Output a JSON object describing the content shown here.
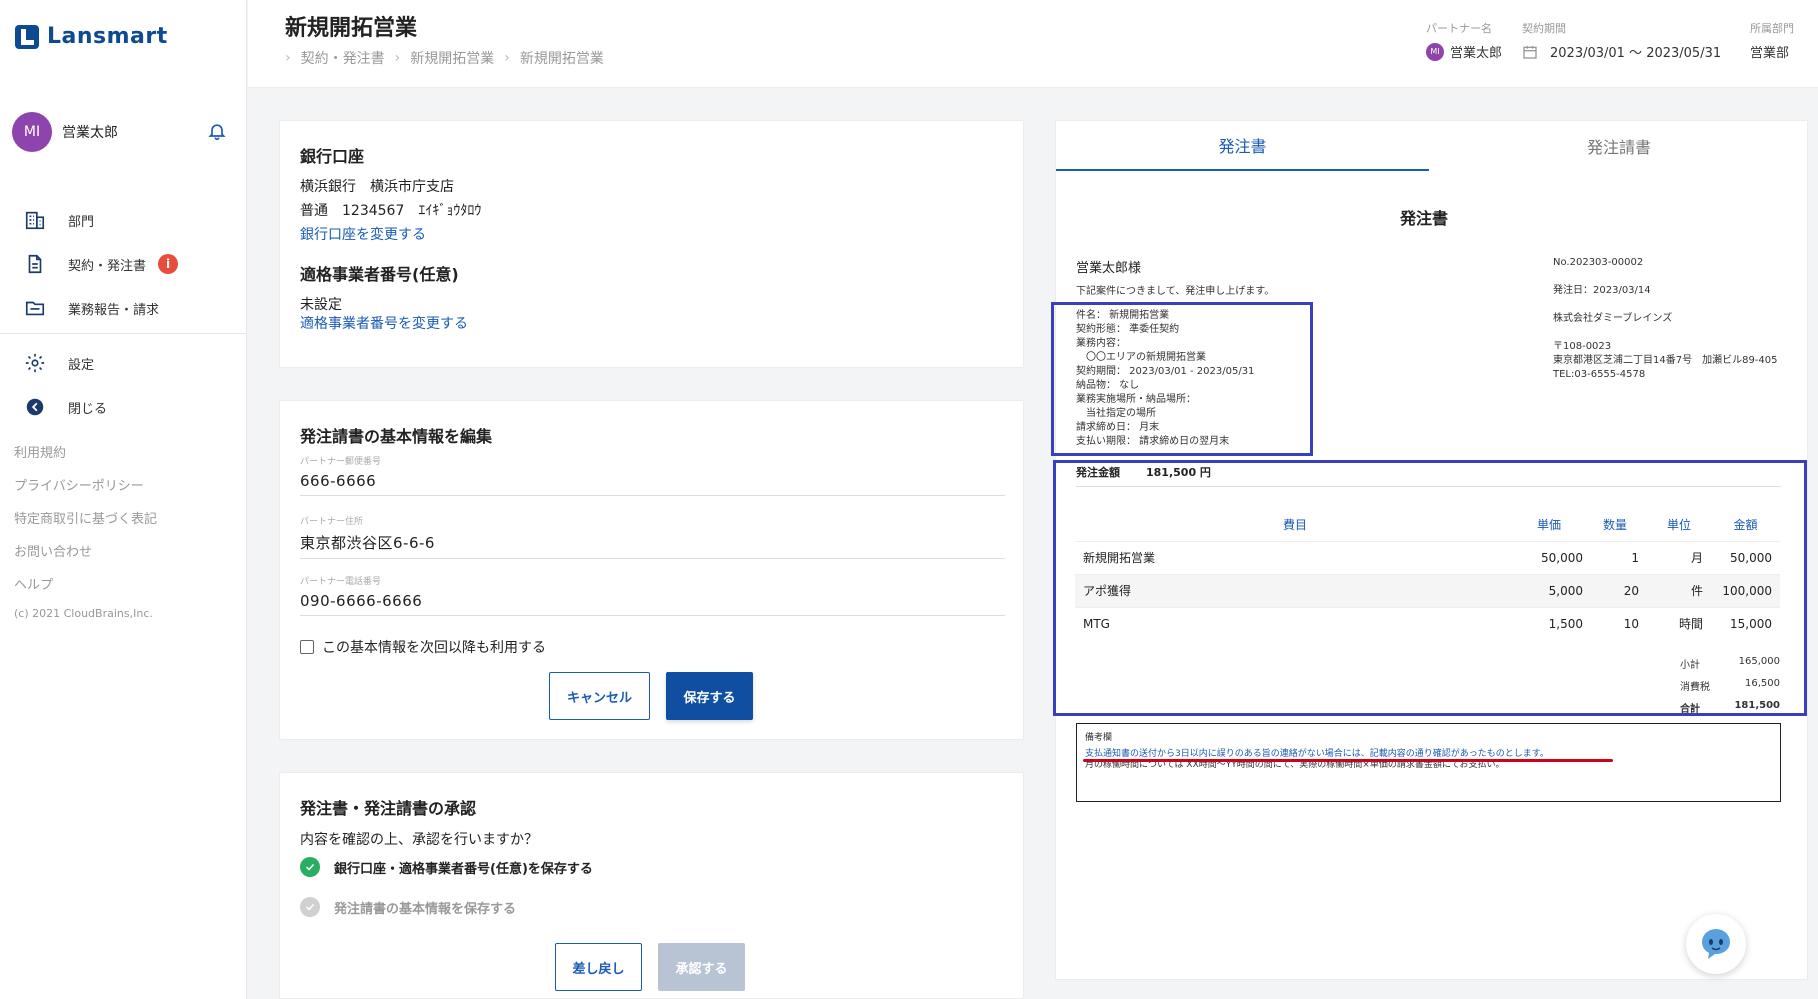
{
  "app": {
    "logo": "Lansmart"
  },
  "user": {
    "initials": "MI",
    "name": "営業太郎"
  },
  "nav": {
    "items": [
      {
        "label": "部門",
        "icon": "building-icon"
      },
      {
        "label": "契約・発注書",
        "icon": "document-icon",
        "badge": "i"
      },
      {
        "label": "業務報告・請求",
        "icon": "folder-icon"
      }
    ],
    "items2": [
      {
        "label": "設定",
        "icon": "gear-icon"
      },
      {
        "label": "閉じる",
        "icon": "arrow-left-icon"
      }
    ],
    "footer": [
      "利用規約",
      "プライバシーポリシー",
      "特定商取引に基づく表記",
      "お問い合わせ",
      "ヘルプ"
    ],
    "copyright": "(c) 2021 CloudBrains,Inc."
  },
  "header": {
    "title": "新規開拓営業",
    "breadcrumb": [
      "契約・発注書",
      "新規開拓営業",
      "新規開拓営業"
    ],
    "partner_label": "パートナー名",
    "partner_initials": "MI",
    "partner_name": "営業太郎",
    "period_label": "契約期間",
    "period_value": "2023/03/01 ～ 2023/05/31",
    "dept_label": "所属部門",
    "dept_value": "営業部"
  },
  "bank": {
    "title": "銀行口座",
    "line1": "横浜銀行　横浜市庁支店",
    "line2": "普通　1234567　ｴｲｷﾞｮｳﾀﾛｳ",
    "change_link": "銀行口座を変更する",
    "invoice_title": "適格事業者番号(任意)",
    "invoice_value": "未設定",
    "invoice_link": "適格事業者番号を変更する"
  },
  "basic": {
    "title": "発注請書の基本情報を編集",
    "fields": [
      {
        "label": "パートナー郵便番号",
        "value": "666-6666"
      },
      {
        "label": "パートナー住所",
        "value": "東京都渋谷区6-6-6"
      },
      {
        "label": "パートナー電話番号",
        "value": "090-6666-6666"
      }
    ],
    "reuse_checkbox": "この基本情報を次回以降も利用する",
    "cancel": "キャンセル",
    "save": "保存する"
  },
  "approval": {
    "title": "発注書・発注請書の承認",
    "question": "内容を確認の上、承認を行いますか？",
    "step1": "銀行口座・適格事業者番号(任意)を保存する",
    "step2": "発注請書の基本情報を保存する",
    "reject": "差し戻し",
    "approve": "承認する"
  },
  "tabs": {
    "active": "発注書",
    "inactive": "発注請書"
  },
  "doc": {
    "title": "発注書",
    "to": "営業太郎様",
    "intro": "下記案件につきまして、発注申し上げます。",
    "details": [
      "件名：  新規開拓営業",
      "契約形態：  準委任契約",
      "業務内容：",
      "　〇〇エリアの新規開拓営業",
      "契約期間：  2023/03/01 - 2023/05/31",
      "納品物：  なし",
      "業務実施場所・納品場所：",
      "　当社指定の場所",
      "請求締め日：  月末",
      "支払い期限：  請求締め日の翌月末"
    ],
    "number": "No.202303-00002",
    "issue_date": "発注日：2023/03/14",
    "company": "株式会社ダミーブレインズ",
    "postal": "〒108-0023",
    "address": "東京都港区芝浦二丁目14番7号　加瀬ビル89-405",
    "tel": "TEL:03-6555-4578",
    "amount_label": "発注金額",
    "amount_value": "181,500 円",
    "table_headers": [
      "費目",
      "単価",
      "数量",
      "単位",
      "金額"
    ],
    "rows": [
      [
        "新規開拓営業",
        "50,000",
        "1",
        "月",
        "50,000"
      ],
      [
        "アポ獲得",
        "5,000",
        "20",
        "件",
        "100,000"
      ],
      [
        "MTG",
        "1,500",
        "10",
        "時間",
        "15,000"
      ]
    ],
    "subtotal_label": "小計",
    "subtotal": "165,000",
    "tax_label": "消費税",
    "tax": "16,500",
    "total_label": "合計",
    "total": "181,500",
    "remarks_label": "備考欄",
    "remarks_line1": "支払通知書の送付から3日以内に誤りのある旨の連絡がない場合には、記載内容の通り確認があったものとします。",
    "remarks_line2": "月の稼働時間については XX時間～YY時間の間にて、実際の稼働時間×単価の請求書金額にてお支払い。"
  },
  "colors": {
    "brand": "#0d4a91",
    "accent": "#1a5bb5",
    "highlight": "#3a3fbf",
    "underline": "#d0021b"
  }
}
